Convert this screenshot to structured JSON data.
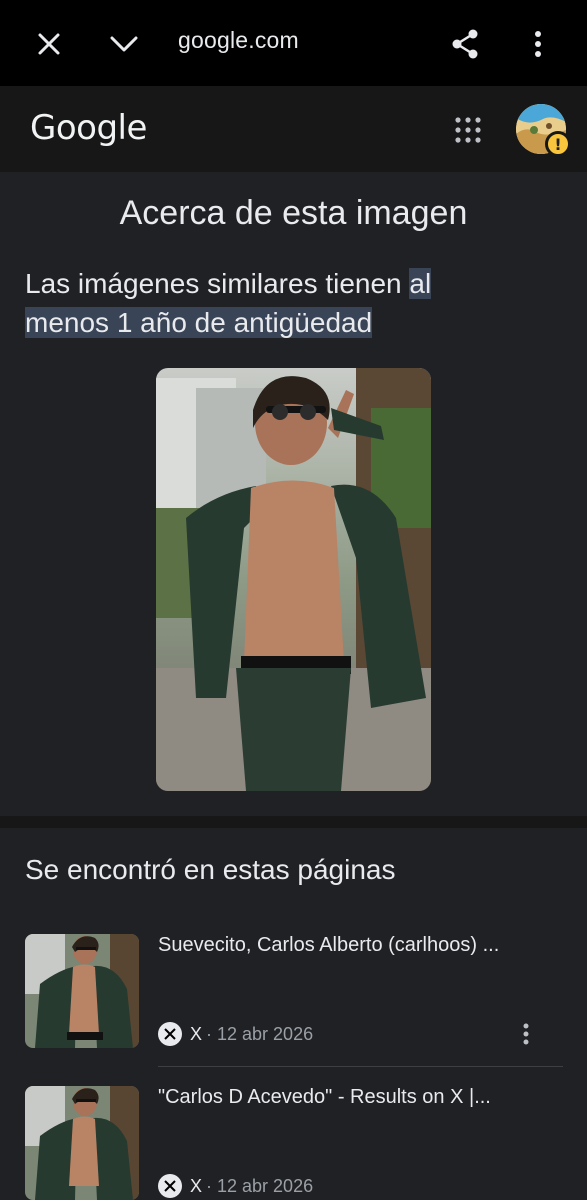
{
  "browser": {
    "url": "google.com",
    "icons": [
      "close-icon",
      "chevron-down-icon",
      "share-icon",
      "more-vert-icon"
    ]
  },
  "header": {
    "logo_text": "Google",
    "apps_icon": "apps-grid-icon",
    "avatar_warning": "!"
  },
  "about": {
    "title": "Acerca de esta imagen",
    "similar_prefix": "Las imágenes similares tienen ",
    "similar_highlight_1": "al",
    "similar_highlight_2": "menos 1 año de antigüedad"
  },
  "pages": {
    "title": "Se encontró en estas páginas",
    "results": [
      {
        "title": "Suevecito, Carlos Alberto (carlhoos) ...",
        "source": "X",
        "date": "· 12 abr 2026"
      },
      {
        "title": "\"Carlos D Acevedo\" - Results on X |...",
        "source": "X",
        "date": "· 12 abr 2026"
      }
    ]
  },
  "colors": {
    "background": "#202124",
    "header": "#171717",
    "highlight": "#394457",
    "text": "#e8eaed",
    "muted": "#9aa0a6"
  }
}
